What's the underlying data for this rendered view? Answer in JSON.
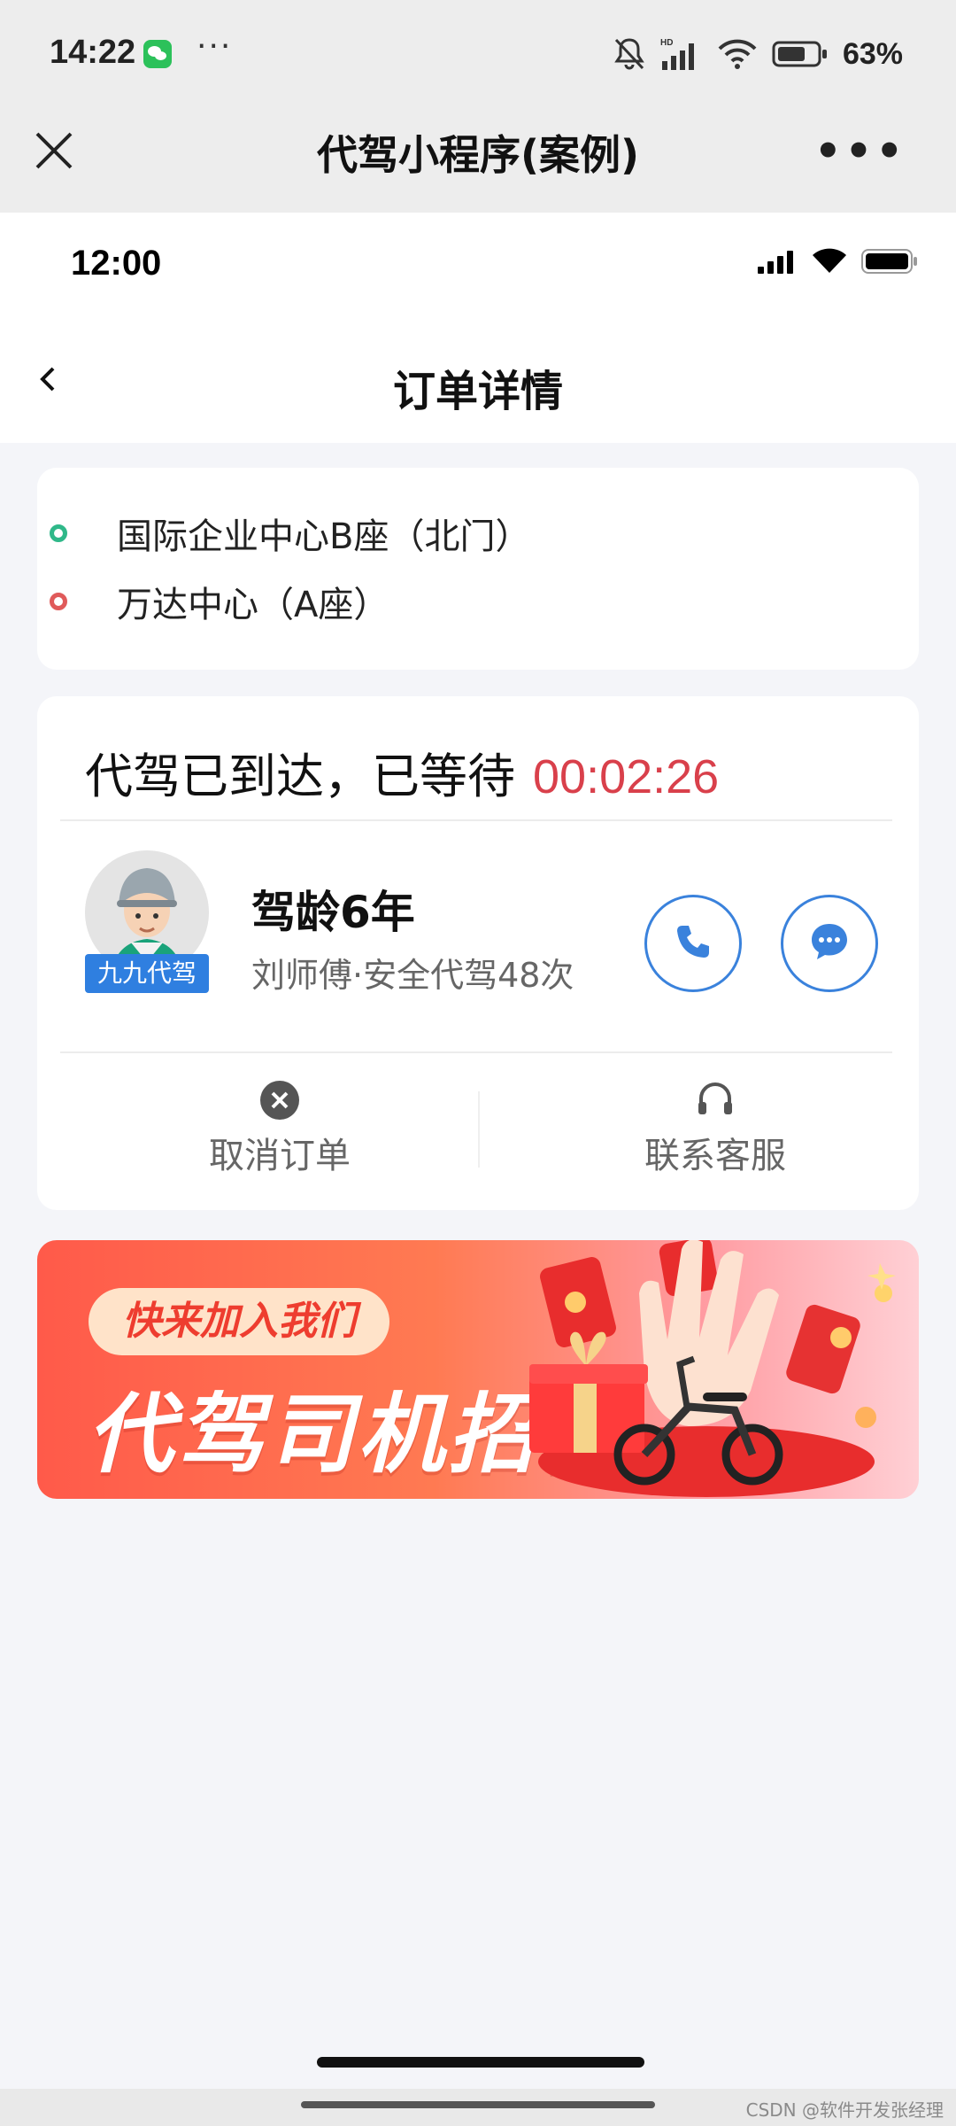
{
  "system_status": {
    "time": "14:22",
    "dots": "···",
    "battery_text": "63%"
  },
  "mini_program": {
    "title": "代驾小程序(案例)",
    "more": "•••"
  },
  "inner_status": {
    "time": "12:00"
  },
  "page": {
    "title": "订单详情"
  },
  "route": {
    "start": "国际企业中心B座（北门）",
    "end": "万达中心（A座）"
  },
  "driver_status": {
    "text": "代驾已到达，已等待",
    "wait_time": "00:02:26"
  },
  "driver": {
    "avatar_tag": "九九代驾",
    "years": "驾龄6年",
    "meta": "刘师傅·安全代驾48次"
  },
  "actions": {
    "cancel": "取消订单",
    "support": "联系客服"
  },
  "banner": {
    "pill": "快来加入我们",
    "title": "代驾司机招募"
  },
  "watermark": "CSDN @软件开发张经理",
  "colors": {
    "accent_blue": "#3a82dc",
    "wait_red": "#d9404b",
    "start_dot": "#2fb889",
    "end_dot": "#e05a5a",
    "banner_red": "#ff5a4a"
  }
}
